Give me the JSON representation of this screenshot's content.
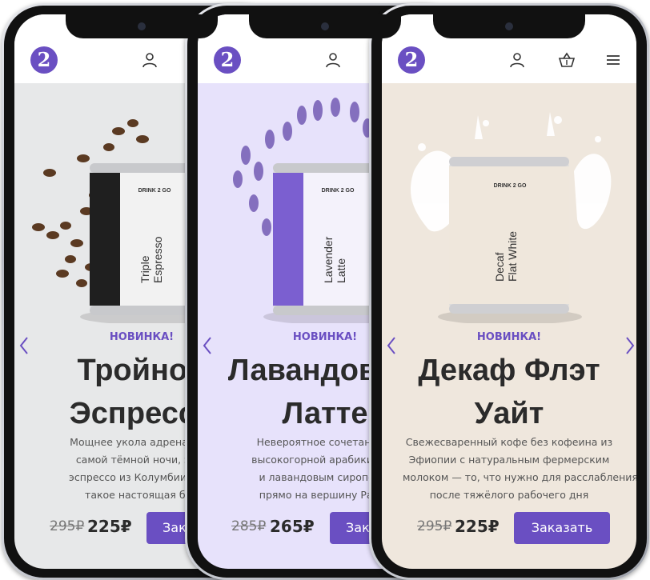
{
  "brand": {
    "logo_glyph": "2",
    "accent": "#6a4fc2"
  },
  "phones": [
    {
      "badge": "НОВИНКА!",
      "title_line1": "Тройной",
      "title_line2": "Эспрессо",
      "description": [
        "Мощнее укола адреналина",
        "самой тёмной ночи, этот",
        "эспрессо из Колумбии пока",
        "такое настоящая бод"
      ],
      "old_price": "295₽",
      "new_price": "225₽",
      "order_label": "Заказать",
      "can_brand": "DRINK 2 GO",
      "can_line1": "Triple",
      "can_line2": "Espresso",
      "background": "#e7e8e9"
    },
    {
      "badge": "НОВИНКА!",
      "title_line1": "Лавандовый",
      "title_line2": "Латте",
      "description": [
        "Невероятное сочетание п",
        "высокогорной арабики с мо",
        "и лавандовым сиропом у",
        "прямо на вершину Радуг"
      ],
      "old_price": "285₽",
      "new_price": "265₽",
      "order_label": "Заказать",
      "can_brand": "DRINK 2 GO",
      "can_line1": "Lavender",
      "can_line2": "Latte",
      "background": "#e7e2fb"
    },
    {
      "badge": "НОВИНКА!",
      "title_line1": "Декаф Флэт",
      "title_line2": "Уайт",
      "description": [
        "Свежесваренный кофе без кофеина из",
        "Эфиопии с натуральным фермерским",
        "молоком — то, что нужно для расслабления",
        "после тяжёлого рабочего дня"
      ],
      "old_price": "295₽",
      "new_price": "225₽",
      "order_label": "Заказать",
      "can_brand": "DRINK 2 GO",
      "can_line1": "Decaf",
      "can_line2": "Flat White",
      "background": "#efe7dd"
    }
  ],
  "icons": [
    "logo-icon",
    "user-icon",
    "basket-icon",
    "menu-icon",
    "arrow-left-icon",
    "arrow-right-icon"
  ]
}
